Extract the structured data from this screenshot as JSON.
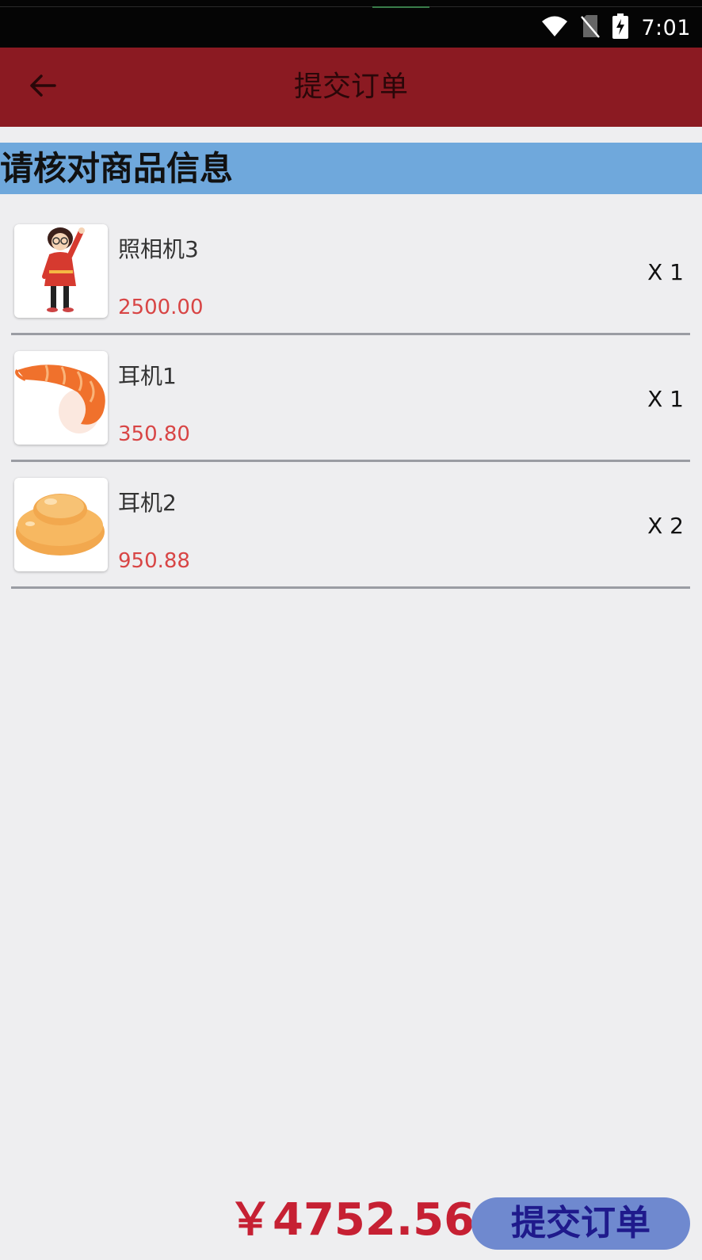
{
  "status_bar": {
    "time": "7:01",
    "icons": [
      "wifi-icon",
      "no-sim-icon",
      "battery-charging-icon"
    ]
  },
  "app_bar": {
    "title": "提交订单",
    "back_icon": "arrow-left-icon"
  },
  "section": {
    "header": "请核对商品信息"
  },
  "items": [
    {
      "name": "照相机3",
      "price": "2500.00",
      "qty": "X 1",
      "image": "girl-illustration"
    },
    {
      "name": "耳机1",
      "price": "350.80",
      "qty": "X 1",
      "image": "shrimp-illustration"
    },
    {
      "name": "耳机2",
      "price": "950.88",
      "qty": "X 2",
      "image": "bun-illustration"
    }
  ],
  "footer": {
    "total": "￥4752.56",
    "submit_label": "提交订单"
  },
  "colors": {
    "app_bar": "#8b1a22",
    "section_header": "#6fa8dc",
    "price": "#d84545",
    "total": "#c62033",
    "submit_button": "#6f89cf"
  }
}
